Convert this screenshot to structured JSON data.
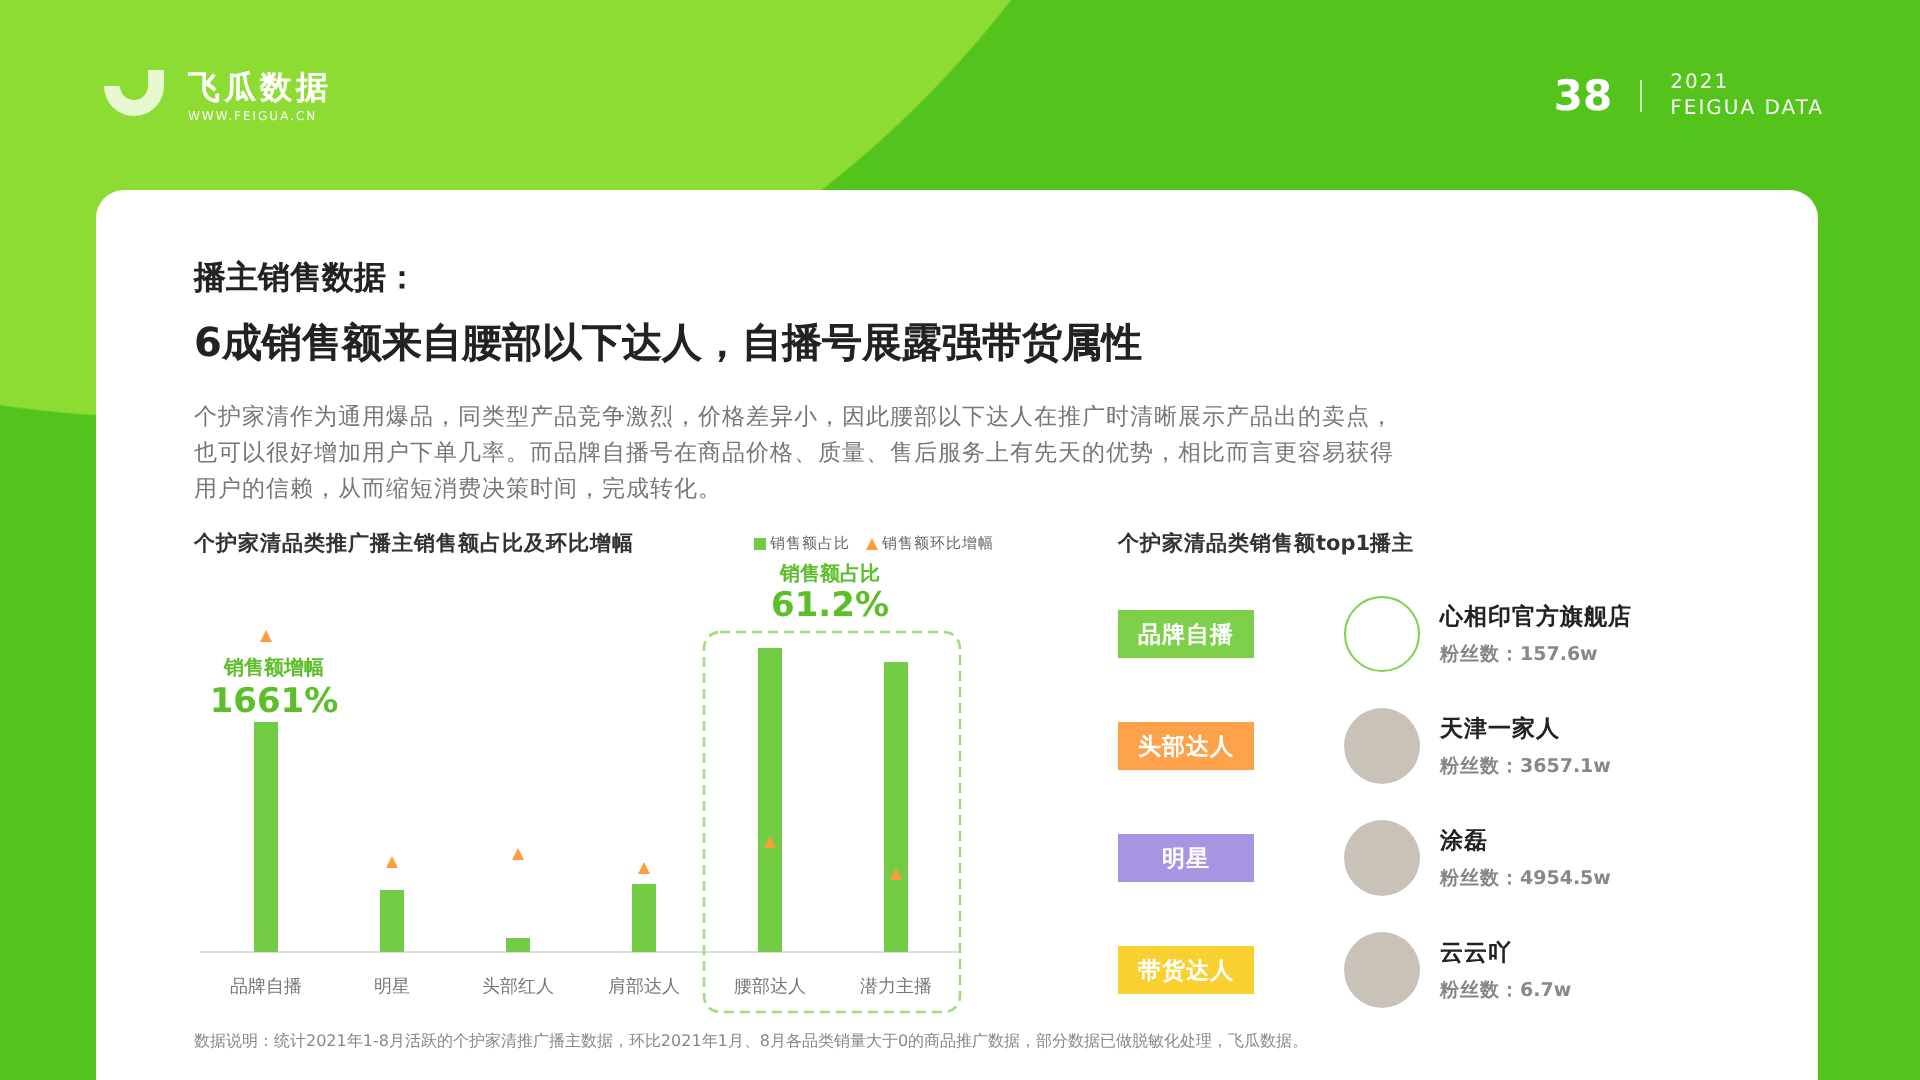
{
  "header": {
    "logo_text": "飞瓜数据",
    "logo_url": "WWW.FEIGUA.CN",
    "page_number": "38",
    "year": "2021",
    "brand": "FEIGUA DATA"
  },
  "headline": {
    "kicker": "播主销售数据：",
    "title": "6成销售额来自腰部以下达人，自播号展露强带货属性"
  },
  "intro": "个护家清作为通用爆品，同类型产品竞争激烈，价格差异小，因此腰部以下达人在推广时清晰展示产品出的卖点，也可以很好增加用户下单几率。而品牌自播号在商品价格、质量、售后服务上有先天的优势，相比而言更容易获得用户的信赖，从而缩短消费决策时间，完成转化。",
  "left_chart": {
    "title": "个护家清品类推广播主销售额占比及环比增幅",
    "legend": [
      {
        "label": "销售额占比",
        "kind": "bar"
      },
      {
        "label": "销售额环比增幅",
        "kind": "triangle"
      }
    ],
    "categories": [
      "品牌自播",
      "明星",
      "头部红人",
      "肩部达人",
      "腰部达人",
      "潜力主播"
    ],
    "callouts": [
      {
        "label": "销售额增幅",
        "value": "1661%"
      },
      {
        "label": "销售额占比",
        "value": "61.2%"
      }
    ]
  },
  "right_panel": {
    "title": "个护家清品类销售额top1播主",
    "rows": [
      {
        "tag": "品牌自播",
        "color": "#7ed04b",
        "name": "心相印官方旗舰店",
        "fans": "粉丝数：157.6w",
        "kind": "logo"
      },
      {
        "tag": "头部达人",
        "color": "#fda14b",
        "name": "天津一家人",
        "fans": "粉丝数：3657.1w",
        "kind": "photo"
      },
      {
        "tag": "明星",
        "color": "#a795e4",
        "name": "涂磊",
        "fans": "粉丝数：4954.5w",
        "kind": "photo"
      },
      {
        "tag": "带货达人",
        "color": "#f9d030",
        "name": "云云吖",
        "fans": "粉丝数：6.7w",
        "kind": "photo"
      }
    ]
  },
  "footnote": "数据说明：统计2021年1-8月活跃的个护家清推广播主数据，环比2021年1月、8月各品类销量大于0的商品推广数据，部分数据已做脱敏化处理，飞瓜数据。"
}
